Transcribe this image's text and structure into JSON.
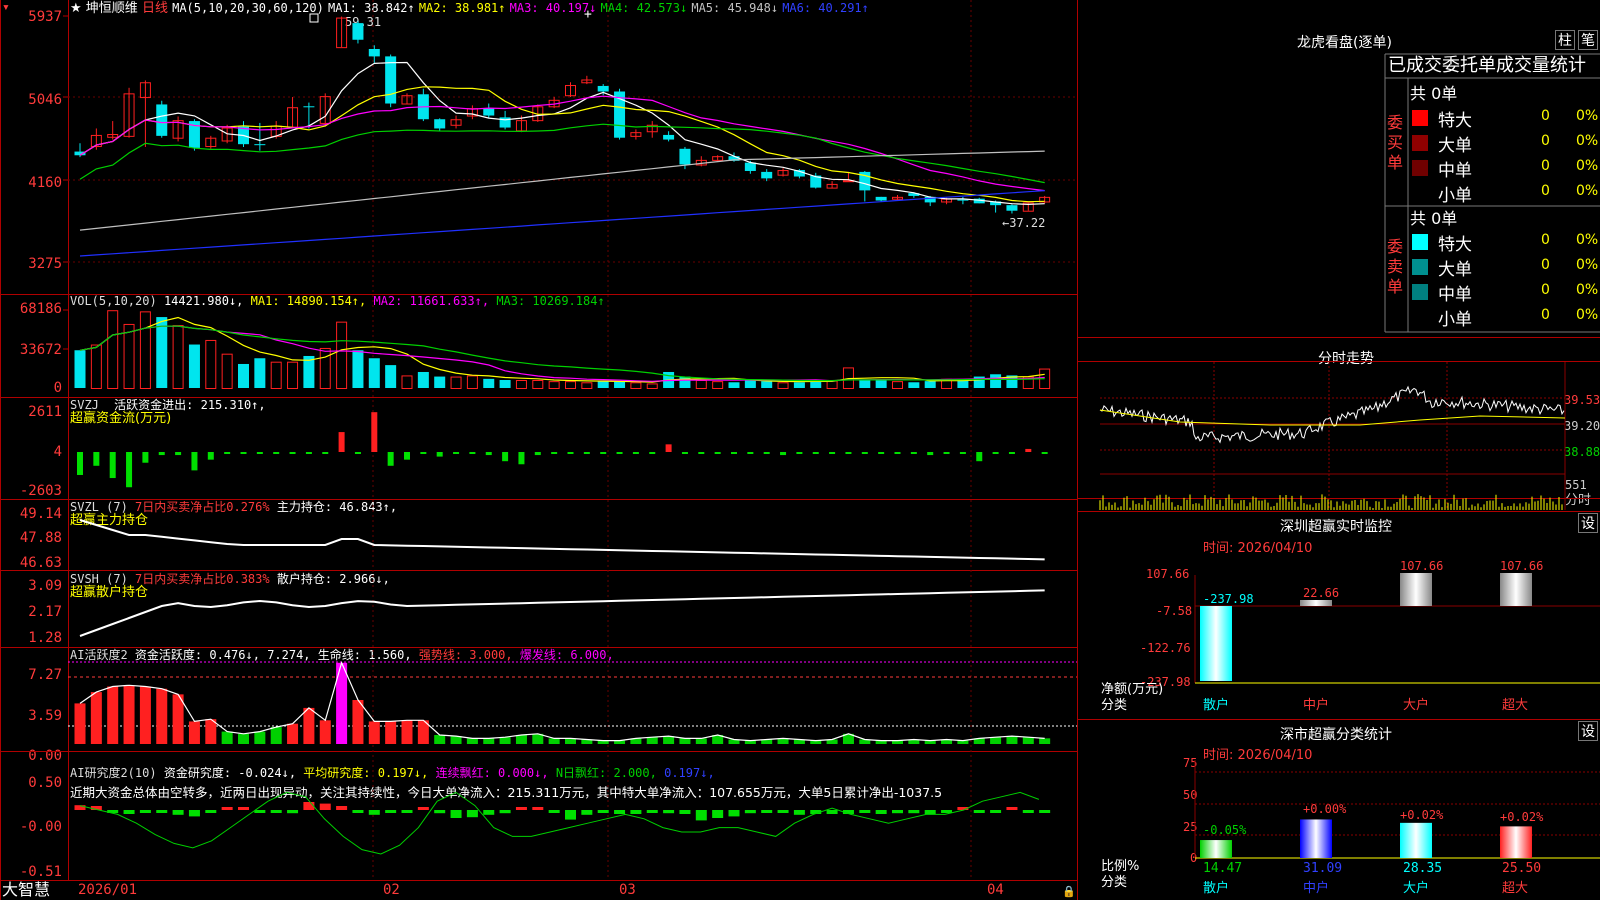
{
  "colors": {
    "up": "#ff2020",
    "down": "#00e5ee",
    "grid": "#b00000",
    "ma1": "#ffffff",
    "ma2": "#ffff00",
    "ma3": "#ff00ff",
    "ma4": "#00d000",
    "ma5": "#c0c0c0",
    "ma6": "#2030ff"
  },
  "main": {
    "star": "★",
    "stock": "坤恒顺维",
    "period": "日线",
    "ma_label": "MA(5,10,20,30,60,120)",
    "ma1": "MA1: 38.842↑",
    "ma2": "MA2: 38.981↑",
    "ma3": "MA3: 40.197↓",
    "ma4": "MA4: 42.573↓",
    "ma5": "MA5: 45.948↓",
    "ma6": "MA6: 40.291↑",
    "high_note": "59.31",
    "low_note": "←37.22",
    "y_labels": [
      "5937",
      "5046",
      "4160",
      "3275"
    ],
    "plus_sign": "+"
  },
  "vol": {
    "title": "VOL(5,10,20)",
    "val": "14421.980↓,",
    "ma1": "MA1: 14890.154↑,",
    "ma2": "MA2: 11661.633↑,",
    "ma3": "MA3: 10269.184↑",
    "y_labels": [
      "68186",
      "33672",
      "0"
    ]
  },
  "svzj": {
    "title": "SVZJ",
    "sub": "活跃资金进出: 215.310↑,",
    "name": "超赢资金流(万元)",
    "y_labels": [
      "2611",
      "4",
      "-2603"
    ]
  },
  "svzl": {
    "title": "SVZL (7)",
    "p1": "7日内买卖净占比0.276%",
    "p2": "主力持仓: 46.843↑,",
    "name": "超赢主力持仓",
    "y_labels": [
      "49.14",
      "47.88",
      "46.63"
    ]
  },
  "svsh": {
    "title": "SVSH (7)",
    "p1": "7日内买卖净占比0.383%",
    "p2": "散户持仓: 2.966↓,",
    "name": "超赢散户持仓",
    "y_labels": [
      "3.09",
      "2.17",
      "1.28"
    ]
  },
  "ai1": {
    "title": "AI活跃度2",
    "p1": "资金活跃度: 0.476↓,",
    "p2": "7.274,",
    "p3": "生命线: 1.560,",
    "p4": "强势线: 3.000,",
    "p5": "爆发线: 6.000,",
    "y_labels": [
      "7.27",
      "3.59",
      "0.00"
    ]
  },
  "ai2": {
    "title": "AI研究度2(10)",
    "p1": "资金研究度: -0.024↓,",
    "p2": "平均研究度: 0.197↓,",
    "p3": "连续飘红: 0.000↓,",
    "p4": "N日飘红: 2.000,",
    "p5": "0.197↓,",
    "comment": "近期大资金总体由空转多，近两日出现异动，关注其持续性，今日大单净流入：215.311万元，其中特大单净流入：107.655万元，大单5日累计净出-1037.5",
    "y_labels": [
      "0.50",
      "-0.00",
      "-0.51"
    ]
  },
  "xaxis": {
    "labels": [
      "2026/01",
      "02",
      "03",
      "04"
    ]
  },
  "footer": {
    "brand": "大智慧"
  },
  "right": {
    "lhkp_title": "龙虎看盘(逐单)",
    "btn1": "柱",
    "btn2": "笔",
    "table_title": "已成交委托单成交量统计",
    "buy_side": "委买单",
    "sell_side": "委卖单",
    "buy_total": "共 0单",
    "sell_total": "共 0单",
    "buy_rows": [
      {
        "label": "特大",
        "qty": "0",
        "pct": "0%",
        "color": "#ff0000"
      },
      {
        "label": "大单",
        "qty": "0",
        "pct": "0%",
        "color": "#900000"
      },
      {
        "label": "中单",
        "qty": "0",
        "pct": "0%",
        "color": "#700000"
      },
      {
        "label": "小单",
        "qty": "0",
        "pct": "0%",
        "color": "#000000"
      }
    ],
    "sell_rows": [
      {
        "label": "特大",
        "qty": "0",
        "pct": "0%",
        "color": "#00ffff"
      },
      {
        "label": "大单",
        "qty": "0",
        "pct": "0%",
        "color": "#009090"
      },
      {
        "label": "中单",
        "qty": "0",
        "pct": "0%",
        "color": "#008080"
      },
      {
        "label": "小单",
        "qty": "0",
        "pct": "0%",
        "color": "#000000"
      }
    ],
    "fs_title": "分时走势",
    "fs_y": [
      "39.53",
      "39.20",
      "38.88"
    ],
    "fs_vol": "551",
    "fs_vol_label": "分时",
    "sz1_title": "深圳超赢实时监控",
    "sz1_time": "时间: 2026/04/10",
    "set1": "设",
    "sz1_y": [
      "107.66",
      "-7.58",
      "-122.76",
      "-237.98"
    ],
    "sz1_vals": [
      "-237.98",
      "22.66",
      "107.66",
      "107.66"
    ],
    "sz1_axis": "净额(万元)",
    "sz1_axis2": "分类",
    "cats": [
      "散户",
      "中户",
      "大户",
      "超大"
    ],
    "sz2_title": "深市超赢分类统计",
    "sz2_time": "时间: 2026/04/10",
    "set2": "设",
    "sz2_y": [
      "75",
      "50",
      "25",
      "0"
    ],
    "sz2_pcts": [
      "-0.05%",
      "+0.00%",
      "+0.02%",
      "+0.02%"
    ],
    "sz2_vals": [
      "14.47",
      "31.09",
      "28.35",
      "25.50"
    ],
    "sz2_axis": "比例%",
    "sz2_axis2": "分类"
  },
  "chart_data": {
    "type": "candlestick",
    "ohlc": [
      [
        4470,
        4430,
        4560,
        4410
      ],
      [
        4530,
        4650,
        4720,
        4490
      ],
      [
        4630,
        4660,
        4800,
        4600
      ],
      [
        4640,
        5100,
        5160,
        4620
      ],
      [
        5060,
        5220,
        5240,
        4520
      ],
      [
        4980,
        4640,
        5020,
        4620
      ],
      [
        4620,
        4810,
        4850,
        4580
      ],
      [
        4800,
        4510,
        4820,
        4480
      ],
      [
        4530,
        4620,
        4640,
        4500
      ],
      [
        4590,
        4730,
        4760,
        4560
      ],
      [
        4740,
        4550,
        4800,
        4520
      ],
      [
        4550,
        4540,
        4780,
        4480
      ],
      [
        4640,
        4750,
        4800,
        4610
      ],
      [
        4740,
        4950,
        5060,
        4730
      ],
      [
        4960,
        4950,
        5000,
        4720
      ],
      [
        4780,
        5070,
        5100,
        4740
      ],
      [
        5600,
        5920,
        5931,
        5600
      ],
      [
        5860,
        5680,
        5880,
        5640
      ],
      [
        5580,
        5500,
        5620,
        5430
      ],
      [
        5500,
        4990,
        5520,
        4950
      ],
      [
        4990,
        5080,
        5100,
        4990
      ],
      [
        5090,
        4820,
        5150,
        4800
      ],
      [
        4820,
        4720,
        4830,
        4690
      ],
      [
        4760,
        4820,
        4860,
        4720
      ],
      [
        4860,
        4940,
        4970,
        4820
      ],
      [
        4940,
        4860,
        4990,
        4830
      ],
      [
        4840,
        4730,
        4910,
        4710
      ],
      [
        4700,
        4810,
        4860,
        4680
      ],
      [
        4810,
        4960,
        4980,
        4790
      ],
      [
        4960,
        5030,
        5060,
        4940
      ],
      [
        5080,
        5190,
        5220,
        5060
      ],
      [
        5220,
        5250,
        5290,
        5200
      ],
      [
        5180,
        5120,
        5200,
        5080
      ],
      [
        5120,
        4620,
        5150,
        4600
      ],
      [
        4640,
        4680,
        4710,
        4600
      ],
      [
        4690,
        4760,
        4800,
        4620
      ],
      [
        4650,
        4600,
        4690,
        4580
      ],
      [
        4500,
        4330,
        4520,
        4280
      ],
      [
        4330,
        4380,
        4420,
        4310
      ],
      [
        4380,
        4420,
        4430,
        4360
      ],
      [
        4420,
        4370,
        4460,
        4360
      ],
      [
        4350,
        4260,
        4370,
        4230
      ],
      [
        4250,
        4180,
        4280,
        4150
      ],
      [
        4220,
        4270,
        4290,
        4200
      ],
      [
        4270,
        4200,
        4280,
        4180
      ],
      [
        4210,
        4080,
        4240,
        4070
      ],
      [
        4080,
        4120,
        4150,
        4070
      ],
      [
        4150,
        4160,
        4250,
        4150
      ],
      [
        4250,
        4050,
        4260,
        3930
      ],
      [
        3980,
        3940,
        3980,
        3930
      ],
      [
        3960,
        3980,
        4000,
        3940
      ],
      [
        4020,
        3990,
        4030,
        3970
      ],
      [
        3980,
        3920,
        3990,
        3880
      ],
      [
        3930,
        3960,
        3970,
        3900
      ],
      [
        3950,
        3940,
        3980,
        3900
      ],
      [
        3960,
        3910,
        3970,
        3910
      ],
      [
        3930,
        3890,
        3940,
        3810
      ],
      [
        3890,
        3830,
        3900,
        3800
      ],
      [
        3830,
        3920,
        3920,
        3830
      ],
      [
        3930,
        3980,
        3990,
        3910
      ]
    ],
    "volume": [
      33000,
      38000,
      68000,
      56000,
      67000,
      62000,
      55000,
      38000,
      42000,
      30000,
      21000,
      26000,
      23000,
      23000,
      28000,
      35000,
      58000,
      33000,
      26000,
      20000,
      11000,
      14000,
      10000,
      10000,
      11000,
      8000,
      7000,
      7000,
      7000,
      6000,
      6000,
      5000,
      6000,
      6000,
      5000,
      4000,
      14000,
      10000,
      7000,
      6000,
      5000,
      7000,
      6000,
      5000,
      5000,
      6000,
      7000,
      18000,
      7000,
      7000,
      6000,
      5000,
      6000,
      8000,
      7000,
      10000,
      12000,
      11000,
      10000,
      17000
    ]
  }
}
